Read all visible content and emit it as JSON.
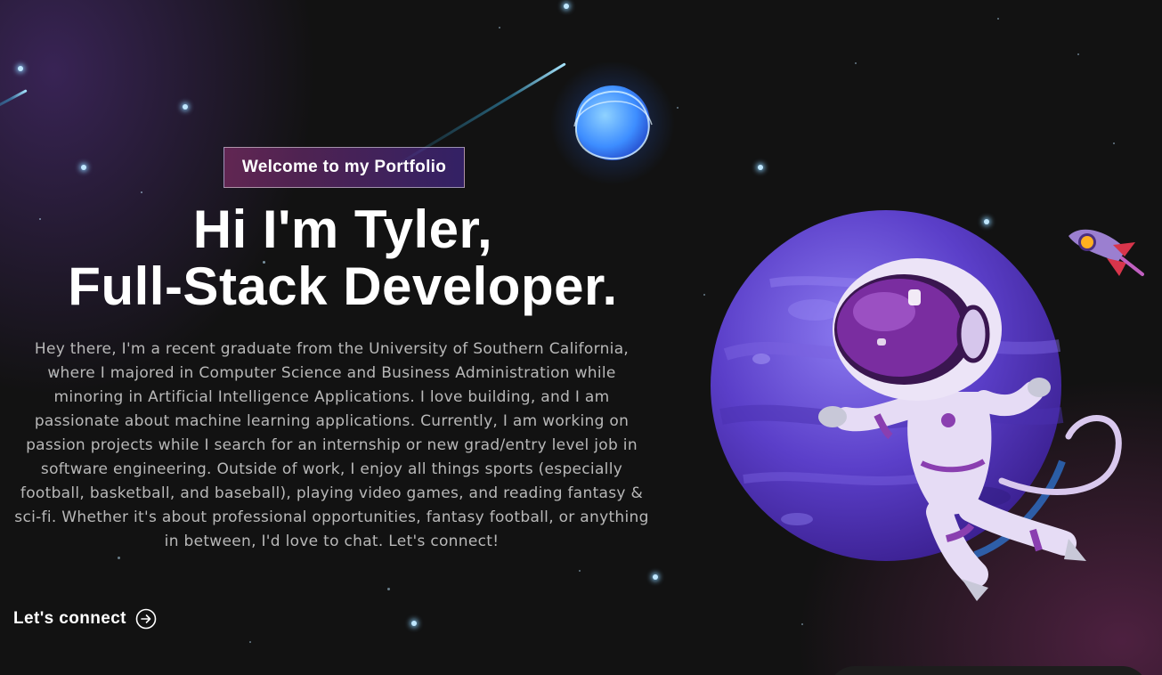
{
  "banner": {
    "tagline": "Welcome to my Portfolio",
    "headline_line1": "Hi I'm Tyler,",
    "headline_line2": "Full-Stack Developer.",
    "intro": "Hey there, I'm a recent graduate from the University of Southern California, where I majored in Computer Science and Business Administration while minoring in Artificial Intelligence Applications. I love building, and I am passionate about machine learning applications. Currently, I am working on passion projects while I search for an internship or new grad/entry level job in software engineering. Outside of work, I enjoy all things sports (especially football, basketball, and baseball), playing video games, and reading fantasy & sci-fi. Whether it's about professional opportunities, fantasy football, or anything in between, I'd love to chat. Let's connect!",
    "connect_label": "Let's connect",
    "connect_icon": "arrow-right-circle-icon"
  },
  "illustration": {
    "planet_icon": "purple-planet",
    "astronaut_icon": "astronaut",
    "rocket_icon": "rocket",
    "moon_icon": "blue-glowing-moon"
  },
  "colors": {
    "background": "#121212",
    "tagline_gradient_start": "#AA367C",
    "tagline_gradient_end": "#4A2FBD",
    "intro_text": "#B8B8B8",
    "planet": "#6A4FD0"
  }
}
